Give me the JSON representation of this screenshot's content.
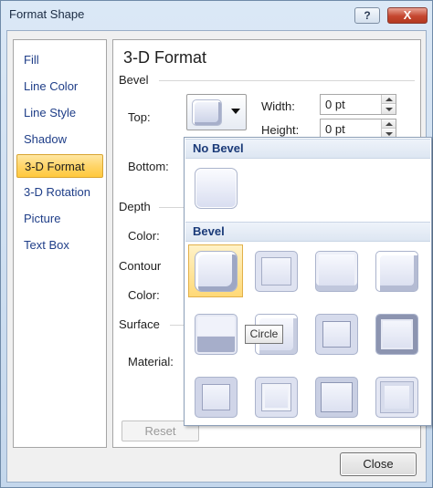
{
  "window": {
    "title": "Format Shape",
    "help_label": "?",
    "close_label": "X"
  },
  "nav": {
    "items": [
      {
        "label": "Fill"
      },
      {
        "label": "Line Color"
      },
      {
        "label": "Line Style"
      },
      {
        "label": "Shadow"
      },
      {
        "label": "3-D Format",
        "selected": true
      },
      {
        "label": "3-D Rotation"
      },
      {
        "label": "Picture"
      },
      {
        "label": "Text Box"
      }
    ]
  },
  "main": {
    "heading": "3-D Format",
    "bevel_section": "Bevel",
    "top_label": "Top:",
    "bottom_label": "Bottom:",
    "width_label": "Width:",
    "width_value": "0 pt",
    "height_label": "Height:",
    "height_value": "0 pt",
    "depth_section": "Depth",
    "depth_color_label": "Color:",
    "contour_section": "Contour",
    "contour_color_label": "Color:",
    "surface_section": "Surface",
    "material_label": "Material:",
    "reset_label": "Reset"
  },
  "gallery": {
    "no_bevel_header": "No Bevel",
    "bevel_header": "Bevel",
    "tooltip": "Circle",
    "tiles": [
      {
        "name": "circle",
        "selected": true
      },
      {
        "name": "relaxed-inset"
      },
      {
        "name": "cross"
      },
      {
        "name": "cool-slant"
      },
      {
        "name": "angle"
      },
      {
        "name": "soft-round"
      },
      {
        "name": "convex"
      },
      {
        "name": "slope"
      },
      {
        "name": "divot"
      },
      {
        "name": "riblet"
      },
      {
        "name": "hard-edge"
      },
      {
        "name": "art-deco"
      }
    ]
  },
  "footer": {
    "close_label": "Close"
  }
}
